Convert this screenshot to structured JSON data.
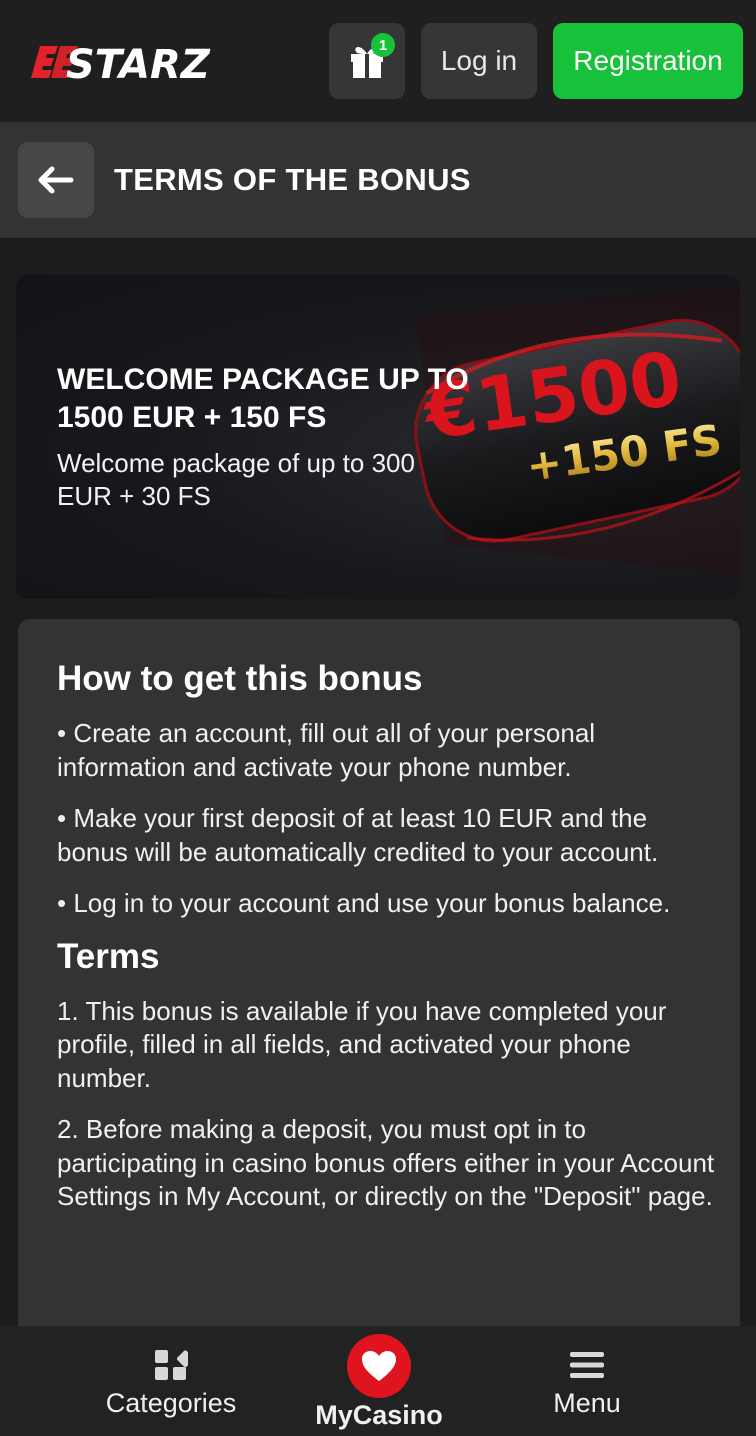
{
  "header": {
    "logo_text": "STARZ",
    "gift_badge_count": "1",
    "login_label": "Log in",
    "registration_label": "Registration",
    "colors": {
      "accent_green": "#17c23a",
      "logo_red": "#e5212a"
    }
  },
  "titlebar": {
    "back_icon": "arrow-left-icon",
    "title": "TERMS OF THE BONUS"
  },
  "banner": {
    "title": "WELCOME PACKAGE UP TO 1500 EUR + 150 FS",
    "subtitle": "Welcome package of up to 300 EUR + 30 FS",
    "art_amount": "€1500",
    "art_fs": "+150 FS"
  },
  "content": {
    "how_heading": "How to get this bonus",
    "how_items": [
      "• Create an account, fill out all of your personal information and activate your phone number.",
      "• Make your first deposit of at least 10 EUR and the bonus will be automatically credited to your account.",
      "• Log in to your account and use your bonus balance."
    ],
    "terms_heading": "Terms",
    "terms_items": [
      "1. This bonus is available if you have completed your profile, filled in all fields, and activated your phone number.",
      "2. Before making a deposit, you must opt in to participating in casino bonus offers either in your Account Settings in My Account, or directly on the \"Deposit\" page."
    ]
  },
  "bottomnav": {
    "categories_label": "Categories",
    "mycasino_label": "MyCasino",
    "menu_label": "Menu",
    "colors": {
      "heart_red": "#e0141e"
    }
  }
}
